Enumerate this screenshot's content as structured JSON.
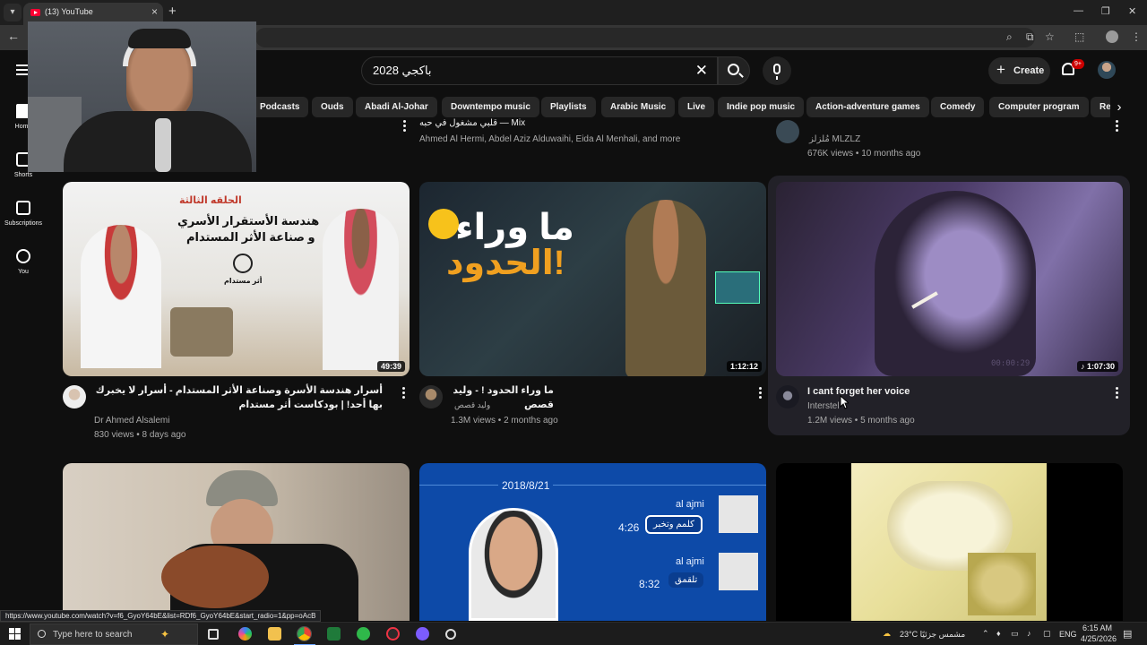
{
  "browser": {
    "tab_title": "(13) YouTube",
    "new_tab": "+",
    "close": "×",
    "minimize": "—",
    "restore": "❐",
    "win_close": "✕",
    "back": "←"
  },
  "header": {
    "search_query": "باكجي 2028",
    "clear": "✕",
    "create_label": "Create",
    "create_plus": "+",
    "notif_badge": "9+"
  },
  "sidebar": {
    "items": [
      {
        "label": "Home",
        "icon": "home-icon"
      },
      {
        "label": "Shorts",
        "icon": "shorts-icon"
      },
      {
        "label": "Subscriptions",
        "icon": "subscriptions-icon"
      },
      {
        "label": "You",
        "icon": "you-icon"
      }
    ]
  },
  "chips": [
    "Podcasts",
    "Ouds",
    "Abadi Al-Johar",
    "Downtempo music",
    "Playlists",
    "Arabic Music",
    "Live",
    "Indie pop music",
    "Action-adventure games",
    "Comedy",
    "Computer program",
    "Re"
  ],
  "chip_next": "›",
  "top_row": {
    "mix_title": "Mix — قلبي مشغول في حبه",
    "mix_artists": "Ahmed Al Hermi, Abdel Aziz Alduwaihi, Eida Al Menhali, and more",
    "right_channel": "مُلزلز MLZLZ",
    "right_meta": "676K views • 10 months ago"
  },
  "videos": [
    {
      "title": "أسرار هندسة الأسرة وصناعة الأثر المستدام - أسرار لا يخبرك بها أحد! | بودكاست أثر مستدام",
      "channel": "Dr Ahmed Alsalemi",
      "meta": "830 views • 8 days ago",
      "duration": "49:39",
      "thumb_heading": "الحلقه الثالثة",
      "thumb_line1": "هندسة الأستقرار الأسري",
      "thumb_line2": "و صناعة الأثر المستدام",
      "thumb_logo": "أثر مستدام"
    },
    {
      "title": "ما وراء الحدود ! - وليد قصص",
      "channel": "وليد قصص",
      "meta": "1.3M views • 2 months ago",
      "duration": "1:12:12",
      "thumb_line1": "ما وراء",
      "thumb_line2": "الحدود!"
    },
    {
      "title": "I cant forget her voice",
      "channel": "Interstel",
      "meta": "1.2M views • 5 months ago",
      "duration": "♪ 1:07:30",
      "thumb_timestamp": "00:00:29"
    }
  ],
  "bottom_row": {
    "chat_date": "2018/8/21",
    "chat_name_1": "al ajmi",
    "chat_time_1": "4:26",
    "chat_msg_1": "كلمم وتخبر",
    "chat_name_2": "al ajmi",
    "chat_time_2": "8:32",
    "chat_msg_2": "تلقمق"
  },
  "status_url": "https://www.youtube.com/watch?v=f6_GyoY64bE&list=RDf6_GyoY64bE&start_radio=1&pp=oAcB",
  "taskbar": {
    "search_placeholder": "Type here to search",
    "weather": "23°C مشمس جزئيًا",
    "lang": "ENG",
    "time": "6:15 AM",
    "date": "4/25/2026"
  },
  "colors": {
    "bg": "#0f0f0f",
    "chip": "#272727",
    "accent": "#ff0033",
    "badge": "#cc0000"
  }
}
